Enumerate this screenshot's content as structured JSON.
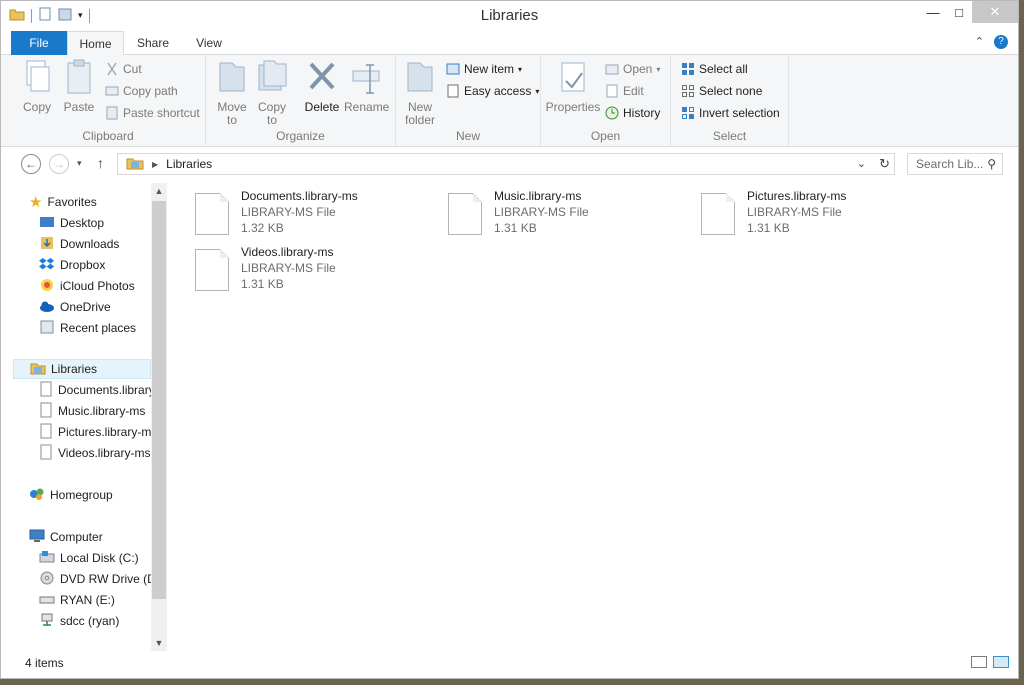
{
  "window": {
    "title": "Libraries"
  },
  "ribbon": {
    "tabs": [
      "File",
      "Home",
      "Share",
      "View"
    ],
    "clipboard": {
      "label": "Clipboard",
      "copy": "Copy",
      "paste": "Paste",
      "cut": "Cut",
      "copy_path": "Copy path",
      "paste_shortcut": "Paste shortcut"
    },
    "organize": {
      "label": "Organize",
      "move_to_1": "Move",
      "move_to_2": "to",
      "copy_to_1": "Copy",
      "copy_to_2": "to",
      "delete": "Delete",
      "rename": "Rename"
    },
    "new": {
      "label": "New",
      "new_folder_1": "New",
      "new_folder_2": "folder",
      "new_item": "New item",
      "easy_access": "Easy access"
    },
    "open": {
      "label": "Open",
      "properties": "Properties",
      "open": "Open",
      "edit": "Edit",
      "history": "History"
    },
    "select": {
      "label": "Select",
      "select_all": "Select all",
      "select_none": "Select none",
      "invert_selection": "Invert selection"
    }
  },
  "address": {
    "path": "Libraries",
    "search_placeholder": "Search Lib..."
  },
  "navpane": {
    "favorites": "Favorites",
    "favorites_items": [
      "Desktop",
      "Downloads",
      "Dropbox",
      "iCloud Photos",
      "OneDrive",
      "Recent places"
    ],
    "libraries": "Libraries",
    "libraries_items": [
      "Documents.library-ms",
      "Music.library-ms",
      "Pictures.library-ms",
      "Videos.library-ms"
    ],
    "homegroup": "Homegroup",
    "computer": "Computer",
    "computer_items": [
      "Local Disk (C:)",
      "DVD RW Drive (D:)",
      "RYAN (E:)",
      "sdcc (ryan)"
    ]
  },
  "files": [
    {
      "name": "Documents.library-ms",
      "type": "LIBRARY-MS File",
      "size": "1.32 KB"
    },
    {
      "name": "Music.library-ms",
      "type": "LIBRARY-MS File",
      "size": "1.31 KB"
    },
    {
      "name": "Pictures.library-ms",
      "type": "LIBRARY-MS File",
      "size": "1.31 KB"
    },
    {
      "name": "Videos.library-ms",
      "type": "LIBRARY-MS File",
      "size": "1.31 KB"
    }
  ],
  "status": {
    "item_count": "4 items"
  },
  "colors": {
    "accent": "#1979ca",
    "ribbon_bg": "#f5f6f7",
    "selection": "#e5f3fb"
  }
}
